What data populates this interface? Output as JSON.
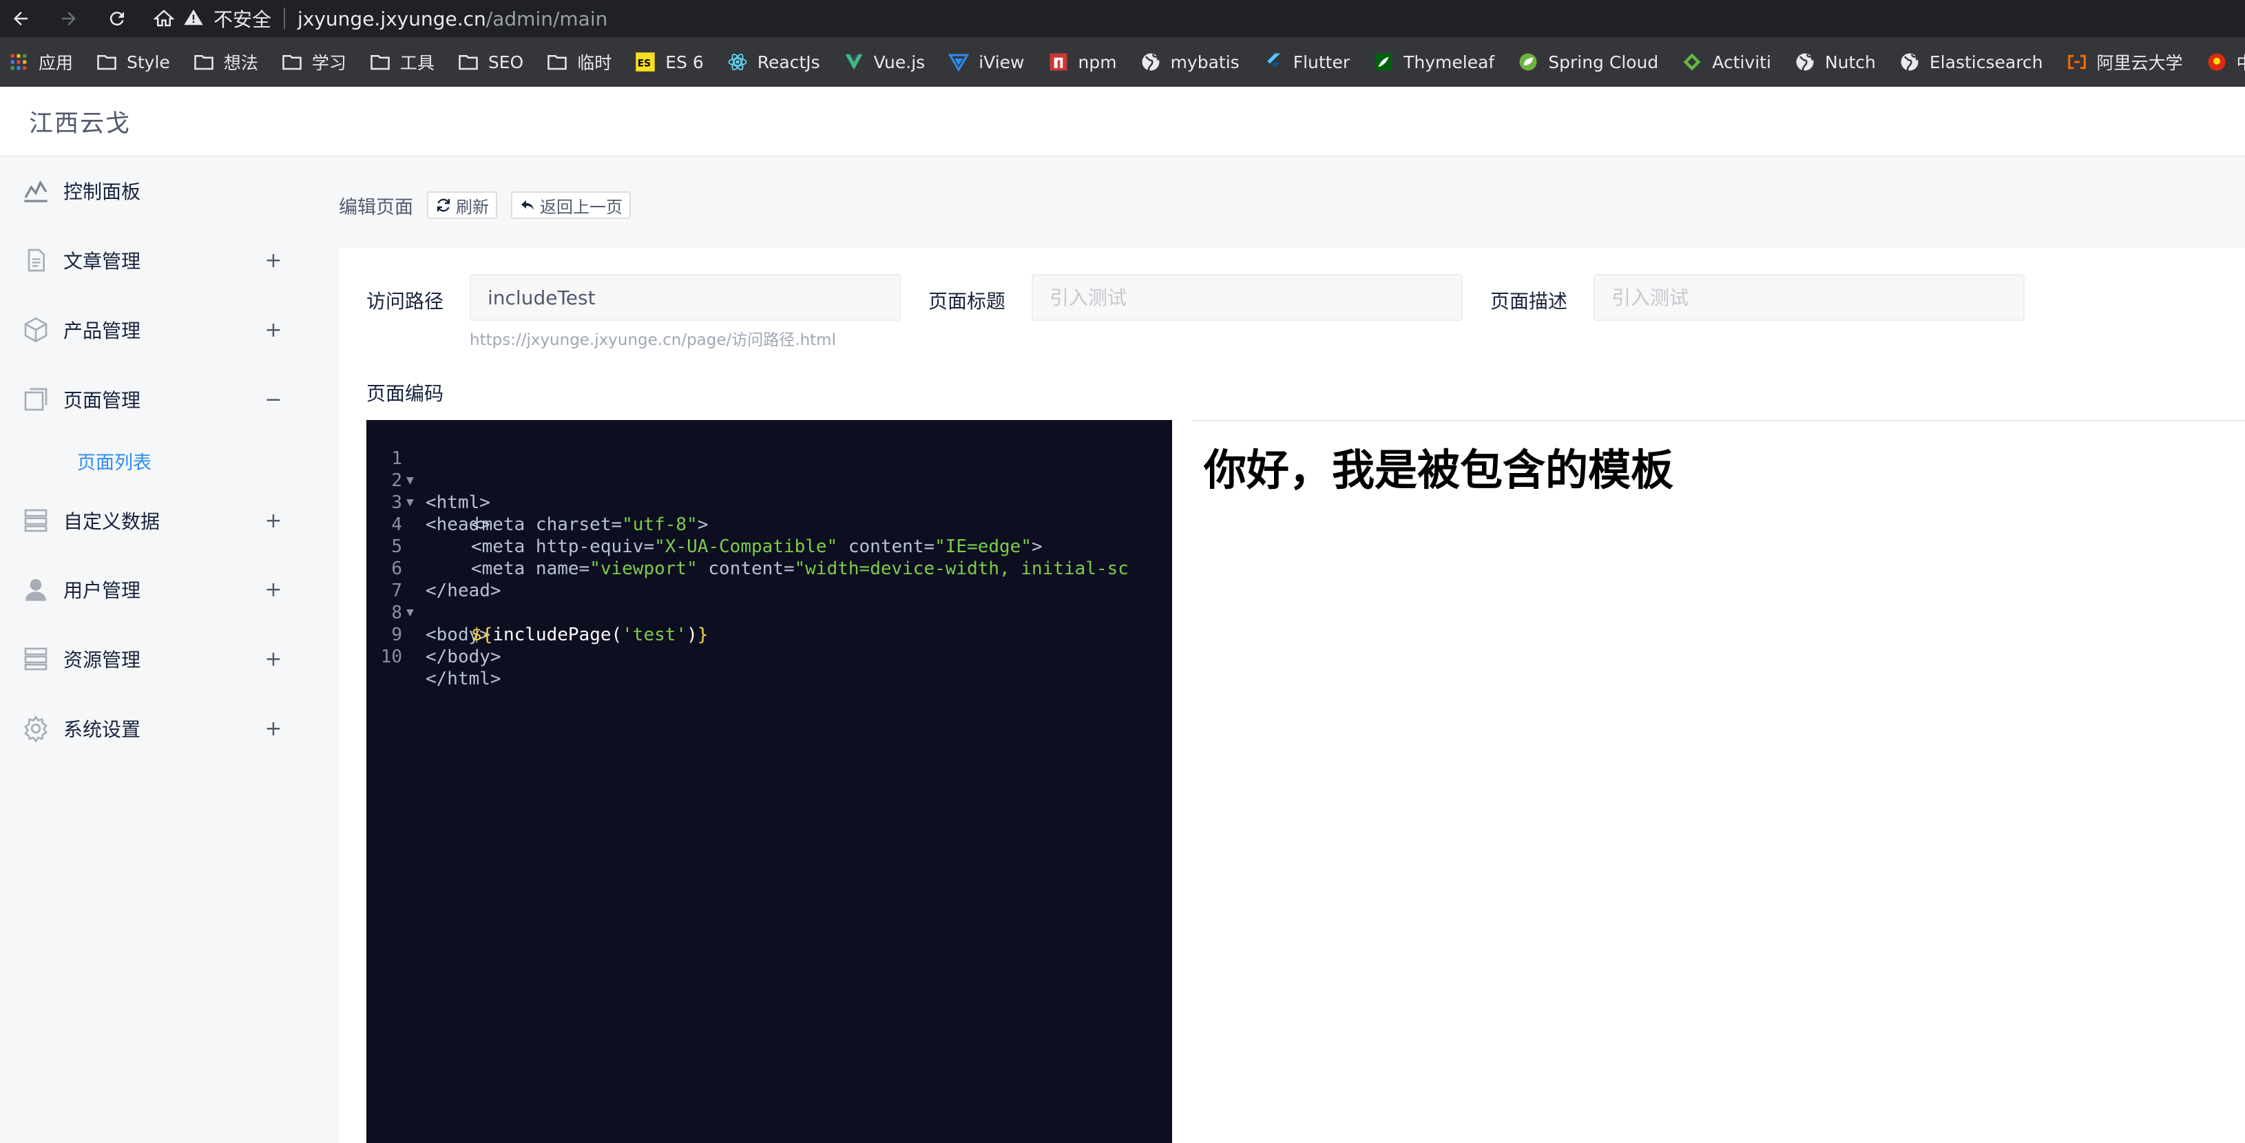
{
  "browser": {
    "insecure_label": "不安全",
    "url_host": "jxyunge.jxyunge.cn",
    "url_path": "/admin/main",
    "bookmarks": [
      {
        "label": "应用",
        "icon": "apps-grid-icon"
      },
      {
        "label": "Style",
        "icon": "folder-icon"
      },
      {
        "label": "想法",
        "icon": "folder-icon"
      },
      {
        "label": "学习",
        "icon": "folder-icon"
      },
      {
        "label": "工具",
        "icon": "folder-icon"
      },
      {
        "label": "SEO",
        "icon": "folder-icon"
      },
      {
        "label": "临时",
        "icon": "folder-icon"
      },
      {
        "label": "ES 6",
        "icon": "es6-icon"
      },
      {
        "label": "ReactJs",
        "icon": "react-icon"
      },
      {
        "label": "Vue.js",
        "icon": "vue-icon"
      },
      {
        "label": "iView",
        "icon": "iview-icon"
      },
      {
        "label": "npm",
        "icon": "npm-icon"
      },
      {
        "label": "mybatis",
        "icon": "globe-icon"
      },
      {
        "label": "Flutter",
        "icon": "flutter-icon"
      },
      {
        "label": "Thymeleaf",
        "icon": "thymeleaf-icon"
      },
      {
        "label": "Spring Cloud",
        "icon": "spring-icon"
      },
      {
        "label": "Activiti",
        "icon": "activiti-icon"
      },
      {
        "label": "Nutch",
        "icon": "globe-icon"
      },
      {
        "label": "Elasticsearch",
        "icon": "globe-icon"
      },
      {
        "label": "阿里云大学",
        "icon": "aliyun-icon"
      },
      {
        "label": "中国政",
        "icon": "emblem-icon"
      }
    ]
  },
  "app": {
    "brand": "江西云戈"
  },
  "sidebar": {
    "items": [
      {
        "label": "控制面板",
        "icon": "dashboard-icon",
        "toggle": ""
      },
      {
        "label": "文章管理",
        "icon": "document-icon",
        "toggle": "+"
      },
      {
        "label": "产品管理",
        "icon": "cube-icon",
        "toggle": "+"
      },
      {
        "label": "页面管理",
        "icon": "pages-icon",
        "toggle": "−"
      },
      {
        "label": "自定义数据",
        "icon": "server-icon",
        "toggle": "+"
      },
      {
        "label": "用户管理",
        "icon": "user-icon",
        "toggle": "+"
      },
      {
        "label": "资源管理",
        "icon": "server-icon",
        "toggle": "+"
      },
      {
        "label": "系统设置",
        "icon": "gear-icon",
        "toggle": "+"
      }
    ],
    "sub_items": [
      {
        "label": "页面列表"
      }
    ]
  },
  "toolbar": {
    "title": "编辑页面",
    "refresh_label": "刷新",
    "back_label": "返回上一页"
  },
  "form": {
    "path_label": "访问路径",
    "path_value": "includeTest",
    "path_hint": "https://jxyunge.jxyunge.cn/page/访问路径.html",
    "title_label": "页面标题",
    "title_placeholder": "引入测试",
    "desc_label": "页面描述",
    "desc_placeholder": "引入测试",
    "code_label": "页面编码"
  },
  "editor": {
    "lines": [
      {
        "n": "1",
        "fold": true
      },
      {
        "n": "2",
        "fold": true
      },
      {
        "n": "3",
        "fold": false
      },
      {
        "n": "4",
        "fold": false
      },
      {
        "n": "5",
        "fold": false
      },
      {
        "n": "6",
        "fold": false
      },
      {
        "n": "7",
        "fold": true
      },
      {
        "n": "8",
        "fold": false
      },
      {
        "n": "9",
        "fold": false
      },
      {
        "n": "10",
        "fold": false
      }
    ],
    "tokens": {
      "l1_tag": "<html>",
      "l2_tag": "<head>",
      "l3_a": "<meta charset=",
      "l3_s": "\"utf-8\"",
      "l3_b": ">",
      "l4_a": "<meta http-equiv=",
      "l4_s1": "\"X-UA-Compatible\"",
      "l4_b": " content=",
      "l4_s2": "\"IE=edge\"",
      "l4_c": ">",
      "l5_a": "<meta name=",
      "l5_s1": "\"viewport\"",
      "l5_b": " content=",
      "l5_s2": "\"width=device-width, initial-sc",
      "l6_tag": "</head>",
      "l7_tag": "<body>",
      "l8_v1": "${",
      "l8_fn": "includePage(",
      "l8_s": "'test'",
      "l8_fn2": ")",
      "l8_v2": "}",
      "l9_tag": "</body>",
      "l10_tag": "</html>"
    }
  },
  "preview": {
    "heading": "你好，我是被包含的模板"
  },
  "colors": {
    "accent": "#2d8cf0",
    "editor_bg": "#0d0e20",
    "string": "#7ccd4b",
    "variable": "#f2d44d"
  }
}
